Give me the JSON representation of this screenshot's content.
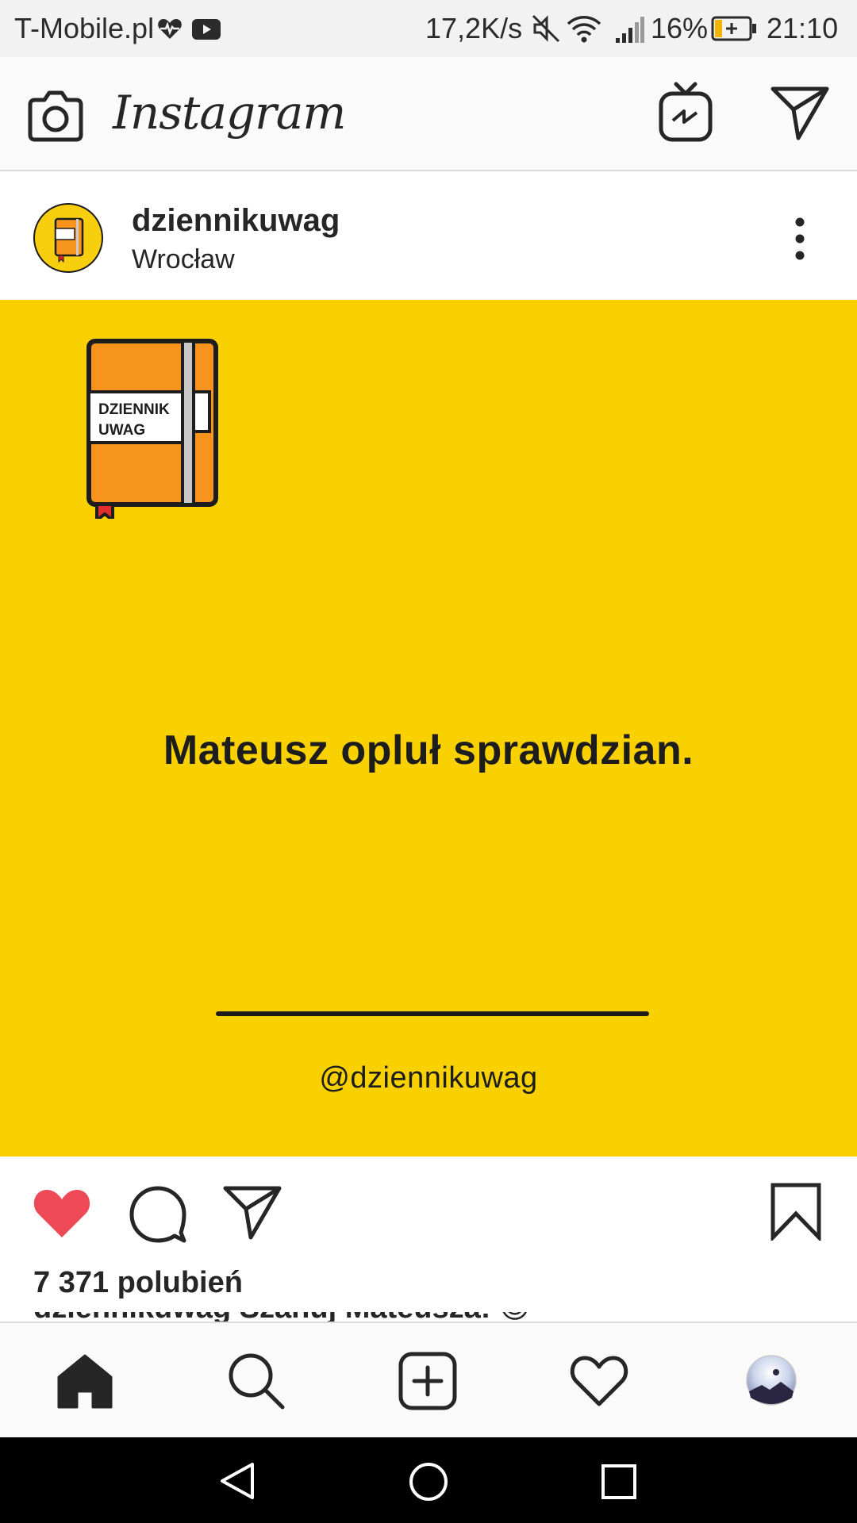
{
  "status_bar": {
    "carrier": "T-Mobile.pl",
    "speed": "17,2K/s",
    "battery_percent": "16%",
    "time": "21:10"
  },
  "header": {
    "app_title": "Instagram",
    "icons": [
      "camera-icon",
      "igtv-icon",
      "direct-message-icon"
    ]
  },
  "post": {
    "username": "dziennikuwag",
    "location": "Wrocław",
    "image": {
      "notebook_label_line1": "DZIENNIK",
      "notebook_label_line2": "UWAG",
      "main_text": "Mateusz opluł sprawdzian.",
      "handle": "@dziennikuwag",
      "background_color": "#f9d100"
    },
    "liked": true,
    "likes_text": "7 371 polubień",
    "caption_partial": "dziennikuwag Szanuj Mateusza! 😊"
  },
  "bottom_nav": {
    "items": [
      "home-icon",
      "search-icon",
      "new-post-icon",
      "activity-icon",
      "profile-avatar"
    ],
    "active": "home-icon"
  },
  "colors": {
    "like_red": "#ed4956",
    "brand_yellow": "#f9d100",
    "notebook_orange": "#f7941d"
  }
}
